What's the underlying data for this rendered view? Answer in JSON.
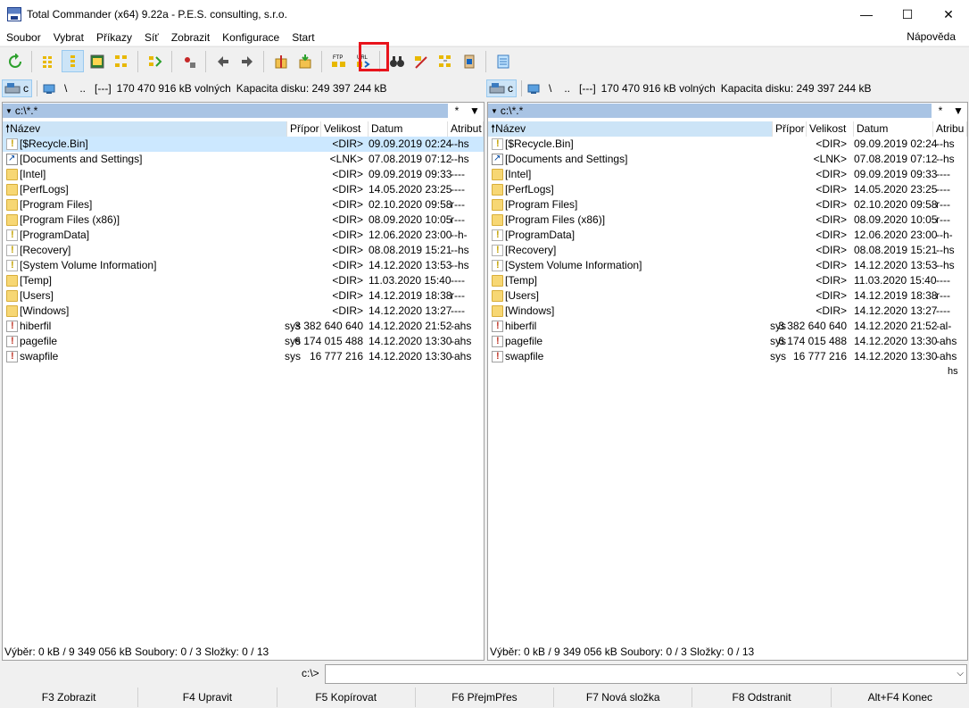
{
  "window": {
    "title": "Total Commander (x64) 9.22a - P.E.S. consulting, s.r.o.",
    "controls": {
      "minimize": "—",
      "maximize": "☐",
      "close": "✕"
    }
  },
  "menu": {
    "items": [
      "Soubor",
      "Vybrat",
      "Příkazy",
      "Síť",
      "Zobrazit",
      "Konfigurace",
      "Start"
    ],
    "help": "Nápověda"
  },
  "toolbar": {
    "buttons": [
      "refresh-icon",
      "brief-view-icon",
      "detailed-view-icon",
      "thumbnail-view-icon",
      "tree-view-icon",
      "invert-selection-icon",
      "pack-files-icon",
      "back-arrow-icon",
      "forward-arrow-icon",
      "archive-pack-icon",
      "archive-unpack-icon",
      "ftp-connect-icon",
      "url-connect-icon",
      "search-binoculars-icon",
      "multi-rename-icon",
      "sync-dirs-icon",
      "copy-names-icon",
      "notepad-icon"
    ],
    "ftp_label": "FTP",
    "url_label": "URL"
  },
  "left_panel": {
    "drive": "c",
    "nav_root": "\\",
    "nav_up": "..",
    "drive_label": "[---]",
    "free_space": "170 470 916 kB volných",
    "capacity": "Kapacita disku: 249 397 244 kB",
    "path": "c:\\*.*",
    "path_star": "*",
    "path_arrow": "▼",
    "columns": {
      "name": "Název",
      "ext": "Přípor",
      "size": "Velikost",
      "date": "Datum",
      "attr": "Atribut"
    },
    "files": [
      {
        "name": "[$Recycle.Bin]",
        "ext": "",
        "size": "<DIR>",
        "date": "09.09.2019 02:24",
        "attr": "--hs",
        "icon": "warn"
      },
      {
        "name": "[Documents and Settings]",
        "ext": "",
        "size": "<LNK>",
        "date": "07.08.2019 07:12",
        "attr": "--hs",
        "icon": "link"
      },
      {
        "name": "[Intel]",
        "ext": "",
        "size": "<DIR>",
        "date": "09.09.2019 09:33",
        "attr": "----",
        "icon": "folder"
      },
      {
        "name": "[PerfLogs]",
        "ext": "",
        "size": "<DIR>",
        "date": "14.05.2020 23:25",
        "attr": "----",
        "icon": "folder"
      },
      {
        "name": "[Program Files]",
        "ext": "",
        "size": "<DIR>",
        "date": "02.10.2020 09:58",
        "attr": "r---",
        "icon": "folder"
      },
      {
        "name": "[Program Files (x86)]",
        "ext": "",
        "size": "<DIR>",
        "date": "08.09.2020 10:05",
        "attr": "r---",
        "icon": "folder"
      },
      {
        "name": "[ProgramData]",
        "ext": "",
        "size": "<DIR>",
        "date": "12.06.2020 23:00",
        "attr": "--h-",
        "icon": "warn"
      },
      {
        "name": "[Recovery]",
        "ext": "",
        "size": "<DIR>",
        "date": "08.08.2019 15:21",
        "attr": "--hs",
        "icon": "warn"
      },
      {
        "name": "[System Volume Information]",
        "ext": "",
        "size": "<DIR>",
        "date": "14.12.2020 13:53",
        "attr": "--hs",
        "icon": "warn"
      },
      {
        "name": "[Temp]",
        "ext": "",
        "size": "<DIR>",
        "date": "11.03.2020 15:40",
        "attr": "----",
        "icon": "folder"
      },
      {
        "name": "[Users]",
        "ext": "",
        "size": "<DIR>",
        "date": "14.12.2019 18:38",
        "attr": "r---",
        "icon": "folder"
      },
      {
        "name": "[Windows]",
        "ext": "",
        "size": "<DIR>",
        "date": "14.12.2020 13:27",
        "attr": "----",
        "icon": "folder"
      },
      {
        "name": "hiberfil",
        "ext": "sys",
        "size": "3 382 640 640",
        "date": "14.12.2020 21:52",
        "attr": "-ahs",
        "icon": "sysfile"
      },
      {
        "name": "pagefile",
        "ext": "sys",
        "size": "6 174 015 488",
        "date": "14.12.2020 13:30",
        "attr": "-ahs",
        "icon": "sysfile"
      },
      {
        "name": "swapfile",
        "ext": "sys",
        "size": "16 777 216",
        "date": "14.12.2020 13:30",
        "attr": "-ahs",
        "icon": "sysfile"
      }
    ],
    "status": "Výběr: 0 kB / 9 349 056 kB  Soubory: 0 / 3  Složky: 0 / 13"
  },
  "right_panel": {
    "drive": "c",
    "nav_root": "\\",
    "nav_up": "..",
    "drive_label": "[---]",
    "free_space": "170 470 916 kB volných",
    "capacity": "Kapacita disku: 249 397 244 kB",
    "path": "c:\\*.*",
    "path_star": "*",
    "path_arrow": "▼",
    "columns": {
      "name": "Název",
      "ext": "Přípor",
      "size": "Velikost",
      "date": "Datum",
      "attr": "Atribu"
    },
    "files": [
      {
        "name": "[$Recycle.Bin]",
        "ext": "",
        "size": "<DIR>",
        "date": "09.09.2019 02:24",
        "attr": "--hs",
        "icon": "warn"
      },
      {
        "name": "[Documents and Settings]",
        "ext": "",
        "size": "<LNK>",
        "date": "07.08.2019 07:12",
        "attr": "--hs",
        "icon": "link"
      },
      {
        "name": "[Intel]",
        "ext": "",
        "size": "<DIR>",
        "date": "09.09.2019 09:33",
        "attr": "----",
        "icon": "folder"
      },
      {
        "name": "[PerfLogs]",
        "ext": "",
        "size": "<DIR>",
        "date": "14.05.2020 23:25",
        "attr": "----",
        "icon": "folder"
      },
      {
        "name": "[Program Files]",
        "ext": "",
        "size": "<DIR>",
        "date": "02.10.2020 09:58",
        "attr": "r---",
        "icon": "folder"
      },
      {
        "name": "[Program Files (x86)]",
        "ext": "",
        "size": "<DIR>",
        "date": "08.09.2020 10:05",
        "attr": "r---",
        "icon": "folder"
      },
      {
        "name": "[ProgramData]",
        "ext": "",
        "size": "<DIR>",
        "date": "12.06.2020 23:00",
        "attr": "--h-",
        "icon": "warn"
      },
      {
        "name": "[Recovery]",
        "ext": "",
        "size": "<DIR>",
        "date": "08.08.2019 15:21",
        "attr": "--hs",
        "icon": "warn"
      },
      {
        "name": "[System Volume Information]",
        "ext": "",
        "size": "<DIR>",
        "date": "14.12.2020 13:53",
        "attr": "--hs",
        "icon": "warn"
      },
      {
        "name": "[Temp]",
        "ext": "",
        "size": "<DIR>",
        "date": "11.03.2020 15:40",
        "attr": "----",
        "icon": "folder"
      },
      {
        "name": "[Users]",
        "ext": "",
        "size": "<DIR>",
        "date": "14.12.2019 18:38",
        "attr": "r---",
        "icon": "folder"
      },
      {
        "name": "[Windows]",
        "ext": "",
        "size": "<DIR>",
        "date": "14.12.2020 13:27",
        "attr": "----",
        "icon": "folder"
      },
      {
        "name": "hiberfil",
        "ext": "sys",
        "size": "3 382 640 640",
        "date": "14.12.2020 21:52",
        "attr": "-al-",
        "icon": "sysfile"
      },
      {
        "name": "pagefile",
        "ext": "sys",
        "size": "6 174 015 488",
        "date": "14.12.2020 13:30",
        "attr": "-ahs",
        "icon": "sysfile"
      },
      {
        "name": "swapfile",
        "ext": "sys",
        "size": "16 777 216",
        "date": "14.12.2020 13:30",
        "attr": "-ahs",
        "icon": "sysfile"
      }
    ],
    "stray_fragment": "hs",
    "status": "Výběr: 0 kB / 9 349 056 kB  Soubory: 0 / 3  Složky: 0 / 13"
  },
  "command_line": {
    "label": "c:\\>",
    "value": "",
    "dropdown": "⌵"
  },
  "function_keys": [
    "F3 Zobrazit",
    "F4 Upravit",
    "F5 Kopírovat",
    "F6 PřejmPřes",
    "F7 Nová složka",
    "F8 Odstranit",
    "Alt+F4 Konec"
  ],
  "colors": {
    "selection": "#cce8ff",
    "path_bar": "#a9c4e4",
    "highlight_box": "#e8141c",
    "folder": "#f7d774"
  }
}
